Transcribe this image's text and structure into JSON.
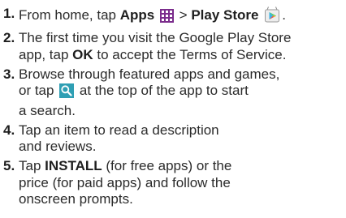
{
  "steps": [
    {
      "num": "1.",
      "line1": {
        "pre": "From home, tap ",
        "apps": "Apps",
        "sep": " > ",
        "store": "Play Store"
      },
      "end": "."
    },
    {
      "num": "2.",
      "line1": "The first time you visit the Google Play Store",
      "line2": {
        "pre": "app, tap ",
        "ok": "OK",
        "post": " to accept the Terms of Service."
      }
    },
    {
      "num": "3.",
      "line1": "Browse through featured apps and games,",
      "line2": {
        "pre": "or tap ",
        "post": " at the top of the app to start"
      },
      "line3": "a search."
    },
    {
      "num": "4.",
      "line1": "Tap an item to read a description",
      "line2": "and reviews."
    },
    {
      "num": "5.",
      "line1": {
        "pre": "Tap ",
        "install": "INSTALL",
        "post": " (for free apps) or the"
      },
      "line2": "price (for paid apps) and follow the",
      "line3": "onscreen prompts."
    }
  ],
  "icons": {
    "apps": "apps-grid-icon",
    "play_store": "play-store-icon",
    "search": "search-icon"
  },
  "colors": {
    "apps_icon": "#7b2d8c",
    "search_icon_bg": "#2f9fb4",
    "text": "#2b2b2b"
  }
}
